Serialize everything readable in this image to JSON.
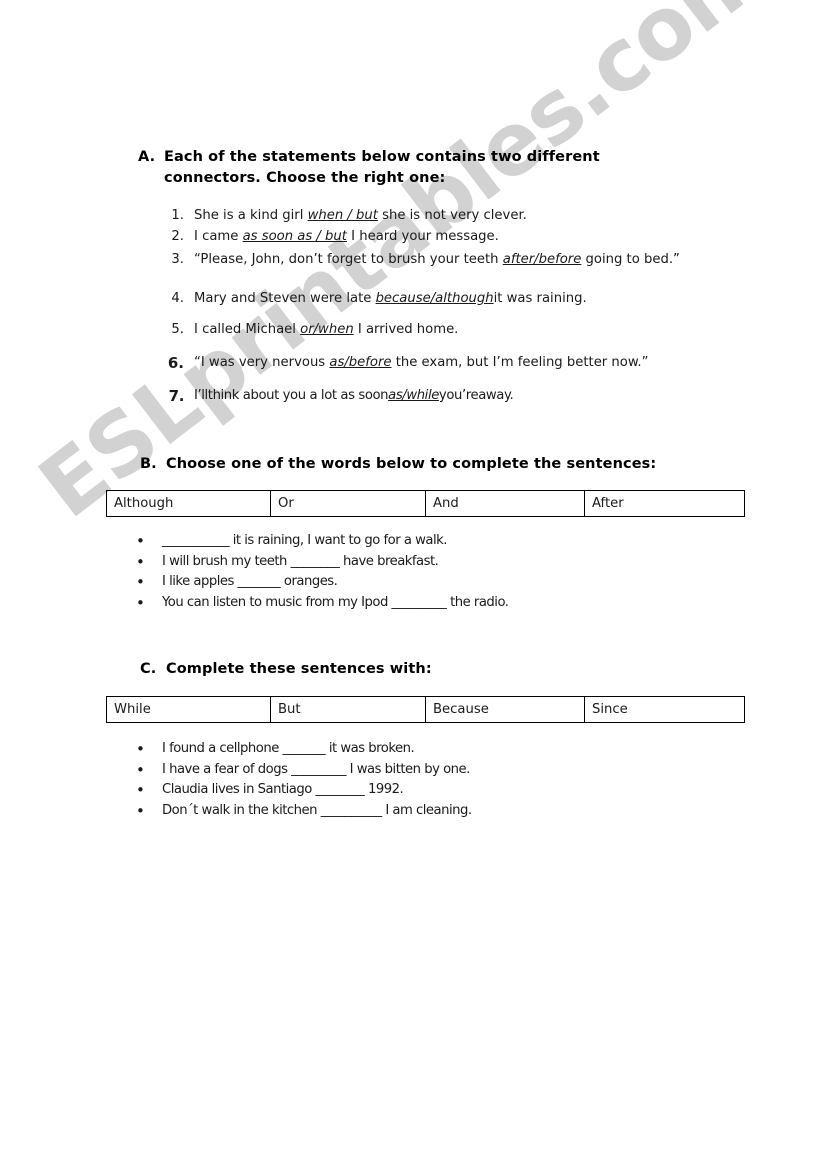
{
  "watermark": {
    "text": "ESLprintables.com",
    "color": "#d2d2d2"
  },
  "sections": {
    "a": {
      "letter": "A.",
      "heading": "Each of the statements below contains two different connectors. Choose the right one:",
      "items": [
        {
          "num": "1.",
          "pre": "She is a kind girl ",
          "choice": "when / but",
          "post": " she is not very clever."
        },
        {
          "num": "2.",
          "pre": "I came ",
          "choice": "as soon as / but",
          "post": " I heard your message."
        },
        {
          "num": "3.",
          "pre": "“Please, John, don’t forget to brush your teeth ",
          "choice": "after/before",
          "post": " going to bed.”"
        },
        {
          "num": "4.",
          "pre": "Mary and Steven were late ",
          "choice": "because/although",
          "post": "it was raining."
        },
        {
          "num": "5.",
          "pre": "I called Michael ",
          "choice": "or/when",
          "post": " I arrived home."
        },
        {
          "num": "6.",
          "pre": "“I was very nervous ",
          "choice": "as/before",
          "post": " the exam, but I’m feeling better now.”"
        },
        {
          "num": "7.",
          "pre": "I’llthink about you a lot as soon",
          "choice": "as/while",
          "post": "you’reaway."
        }
      ]
    },
    "b": {
      "letter": "B.",
      "heading": "Choose one of the words below to complete the sentences:",
      "wordbank": [
        "Although",
        "Or",
        "And",
        "After"
      ],
      "bullets": [
        "___________ it is raining, I want to go for a walk.",
        "I will brush my teeth ________ have breakfast.",
        "I like apples _______ oranges.",
        "You can listen to music from my Ipod _________ the radio."
      ]
    },
    "c": {
      "letter": "C.",
      "heading": "Complete these sentences with:",
      "wordbank": [
        "While",
        "But",
        "Because",
        "Since"
      ],
      "bullets": [
        "I found a cellphone _______ it was broken.",
        "I have a fear of dogs _________ I was bitten by one.",
        "Claudia lives in Santiago ________ 1992.",
        "Don´t walk in the kitchen __________ I am cleaning."
      ]
    }
  },
  "bullet_glyph": "•"
}
